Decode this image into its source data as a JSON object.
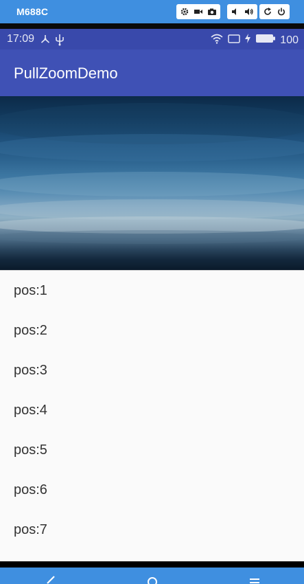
{
  "emulator": {
    "device_name": "M688C",
    "buttons": [
      "settings-icon",
      "video-icon",
      "camera-icon",
      "volume-down-icon",
      "volume-up-icon",
      "rotate-icon",
      "power-icon"
    ]
  },
  "status_bar": {
    "time": "17:09",
    "battery": "100"
  },
  "app_bar": {
    "title": "PullZoomDemo"
  },
  "list": {
    "items": [
      "pos:1",
      "pos:2",
      "pos:3",
      "pos:4",
      "pos:5",
      "pos:6",
      "pos:7"
    ]
  },
  "nav": {
    "buttons": [
      "back-icon",
      "home-icon",
      "menu-icon"
    ]
  },
  "colors": {
    "primary": "#3f51b5",
    "primary_dark": "#3949ab",
    "emulator_blue": "#3f8fe0"
  }
}
